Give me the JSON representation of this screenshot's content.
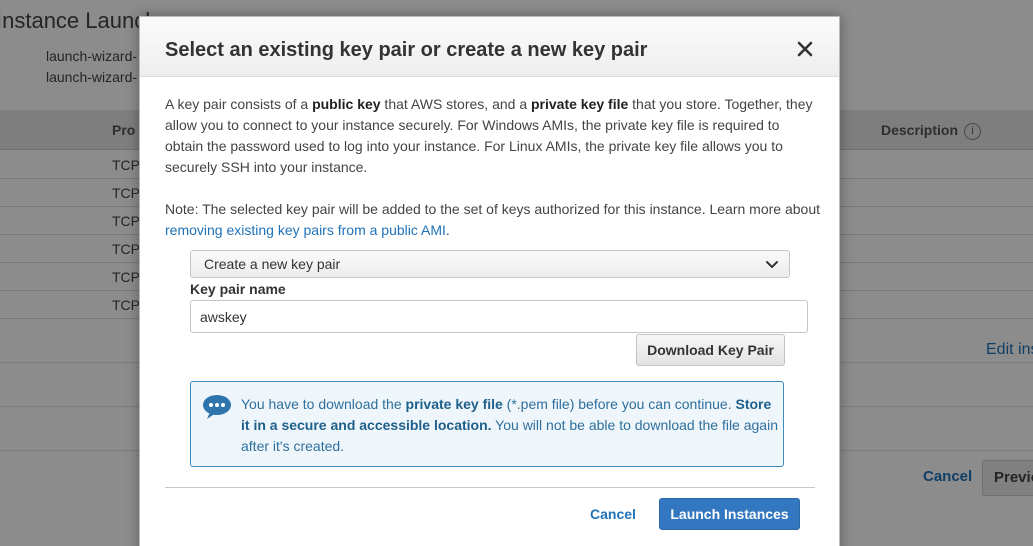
{
  "background": {
    "title": "Instance Launch",
    "security_groups": [
      "launch-wizard-",
      "launch-wizard-"
    ],
    "columns": {
      "protocol": "Pro",
      "description": "Description"
    },
    "rows": [
      "TCP",
      "TCP",
      "TCP",
      "TCP",
      "TCP",
      "TCP"
    ],
    "edit_link": "Edit ins",
    "cancel_label": "Cancel",
    "previous_label": "Previous"
  },
  "modal": {
    "title": "Select an existing key pair or create a new key pair",
    "intro": {
      "t1": "A key pair consists of a ",
      "b1": "public key",
      "t2": " that AWS stores, and a ",
      "b2": "private key file",
      "t3": " that you store. Together, they allow you to connect to your instance securely. For Windows AMIs, the private key file is required to obtain the password used to log into your instance. For Linux AMIs, the private key file allows you to securely SSH into your instance."
    },
    "note": {
      "text": "Note: The selected key pair will be added to the set of keys authorized for this instance. Learn more about ",
      "link": "removing existing key pairs from a public AMI",
      "end": "."
    },
    "key_pair_mode": {
      "selected": "Create a new key pair"
    },
    "key_pair_name": {
      "label": "Key pair name",
      "value": "awskey"
    },
    "download_label": "Download Key Pair",
    "alert": {
      "t1": "You have to download the ",
      "b1": "private key file",
      "t2": " (*.pem file) before you can continue. ",
      "b2": "Store it in a secure and accessible location.",
      "t3": " You will not be able to download the file again after it's created."
    },
    "cancel_label": "Cancel",
    "launch_label": "Launch Instances"
  },
  "colors": {
    "primary_button": "#3377c0",
    "link": "#1f72b8",
    "alert_border": "#3d8bbd",
    "alert_bg": "#eef6fb"
  },
  "icons": {
    "close": "close-icon",
    "dropdown": "chevron-down-icon",
    "alert": "chat-bubble-icon",
    "info": "info-icon"
  }
}
